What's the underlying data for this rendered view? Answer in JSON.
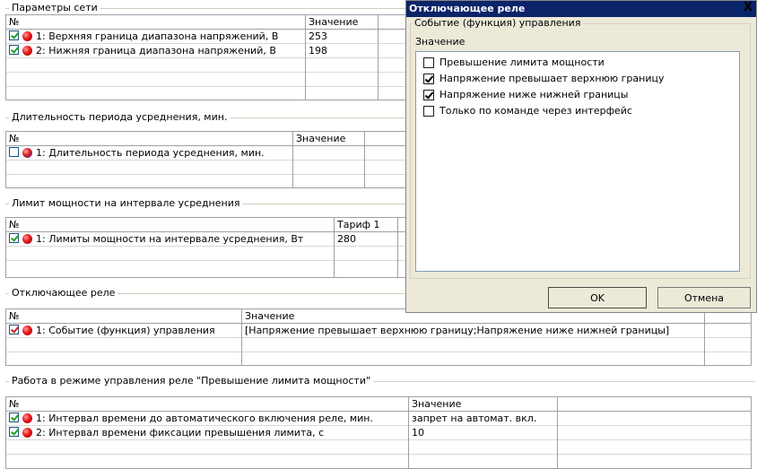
{
  "groups": {
    "network": {
      "title": "Параметры сети",
      "col_num": "№",
      "col_value": "Значение",
      "rows": [
        {
          "label": "1: Верхняя граница диапазона напряжений, В",
          "value": "253",
          "checked": true
        },
        {
          "label": "2: Нижняя граница диапазона напряжений, В",
          "value": "198",
          "checked": true
        }
      ]
    },
    "period": {
      "title": "Длительность периода усреднения, мин.",
      "col_num": "№",
      "col_value": "Значение",
      "rows": [
        {
          "label": "1: Длительность периода усреднения, мин.",
          "value": "",
          "checked": false
        }
      ]
    },
    "limit": {
      "title": "Лимит мощности на интервале усреднения",
      "col_num": "№",
      "col_value": "Тариф 1",
      "rows": [
        {
          "label": "1: Лимиты мощности на интервале усреднения, Вт",
          "value": "280",
          "checked": true
        }
      ]
    },
    "relay": {
      "title": "Отключающее реле",
      "col_num": "№",
      "col_value": "Значение",
      "rows": [
        {
          "label": "1: Событие (функция) управления",
          "value": "[Напряжение превышает верхнюю границу;Напряжение ниже нижней границы]",
          "checked": true
        }
      ]
    },
    "mode": {
      "title": "Работа в режиме управления реле  \"Превышение лимита мощности\"",
      "col_num": "№",
      "col_value": "Значение",
      "rows": [
        {
          "label": "1: Интервал времени до автоматического включения реле, мин.",
          "value": "запрет на автомат. вкл.",
          "checked": true
        },
        {
          "label": "2: Интервал времени фиксации превышения лимита, с",
          "value": "10",
          "checked": true
        }
      ]
    }
  },
  "dialog": {
    "title": "Отключающее реле",
    "close_label": "X",
    "group_title": "Событие (функция) управления",
    "subheader": "Значение",
    "options": [
      {
        "label": "Превышение лимита мощности",
        "checked": false
      },
      {
        "label": "Напряжение превышает верхнюю границу",
        "checked": true
      },
      {
        "label": "Напряжение ниже нижней границы",
        "checked": true
      },
      {
        "label": "Только по команде через интерфейс",
        "checked": false
      }
    ],
    "ok_label": "OK",
    "cancel_label": "Отмена"
  },
  "colors": {
    "titlebar": "#0a246a",
    "dialog_bg": "#ece9d8",
    "check_green": "#21a121",
    "check_red": "#d02020"
  }
}
